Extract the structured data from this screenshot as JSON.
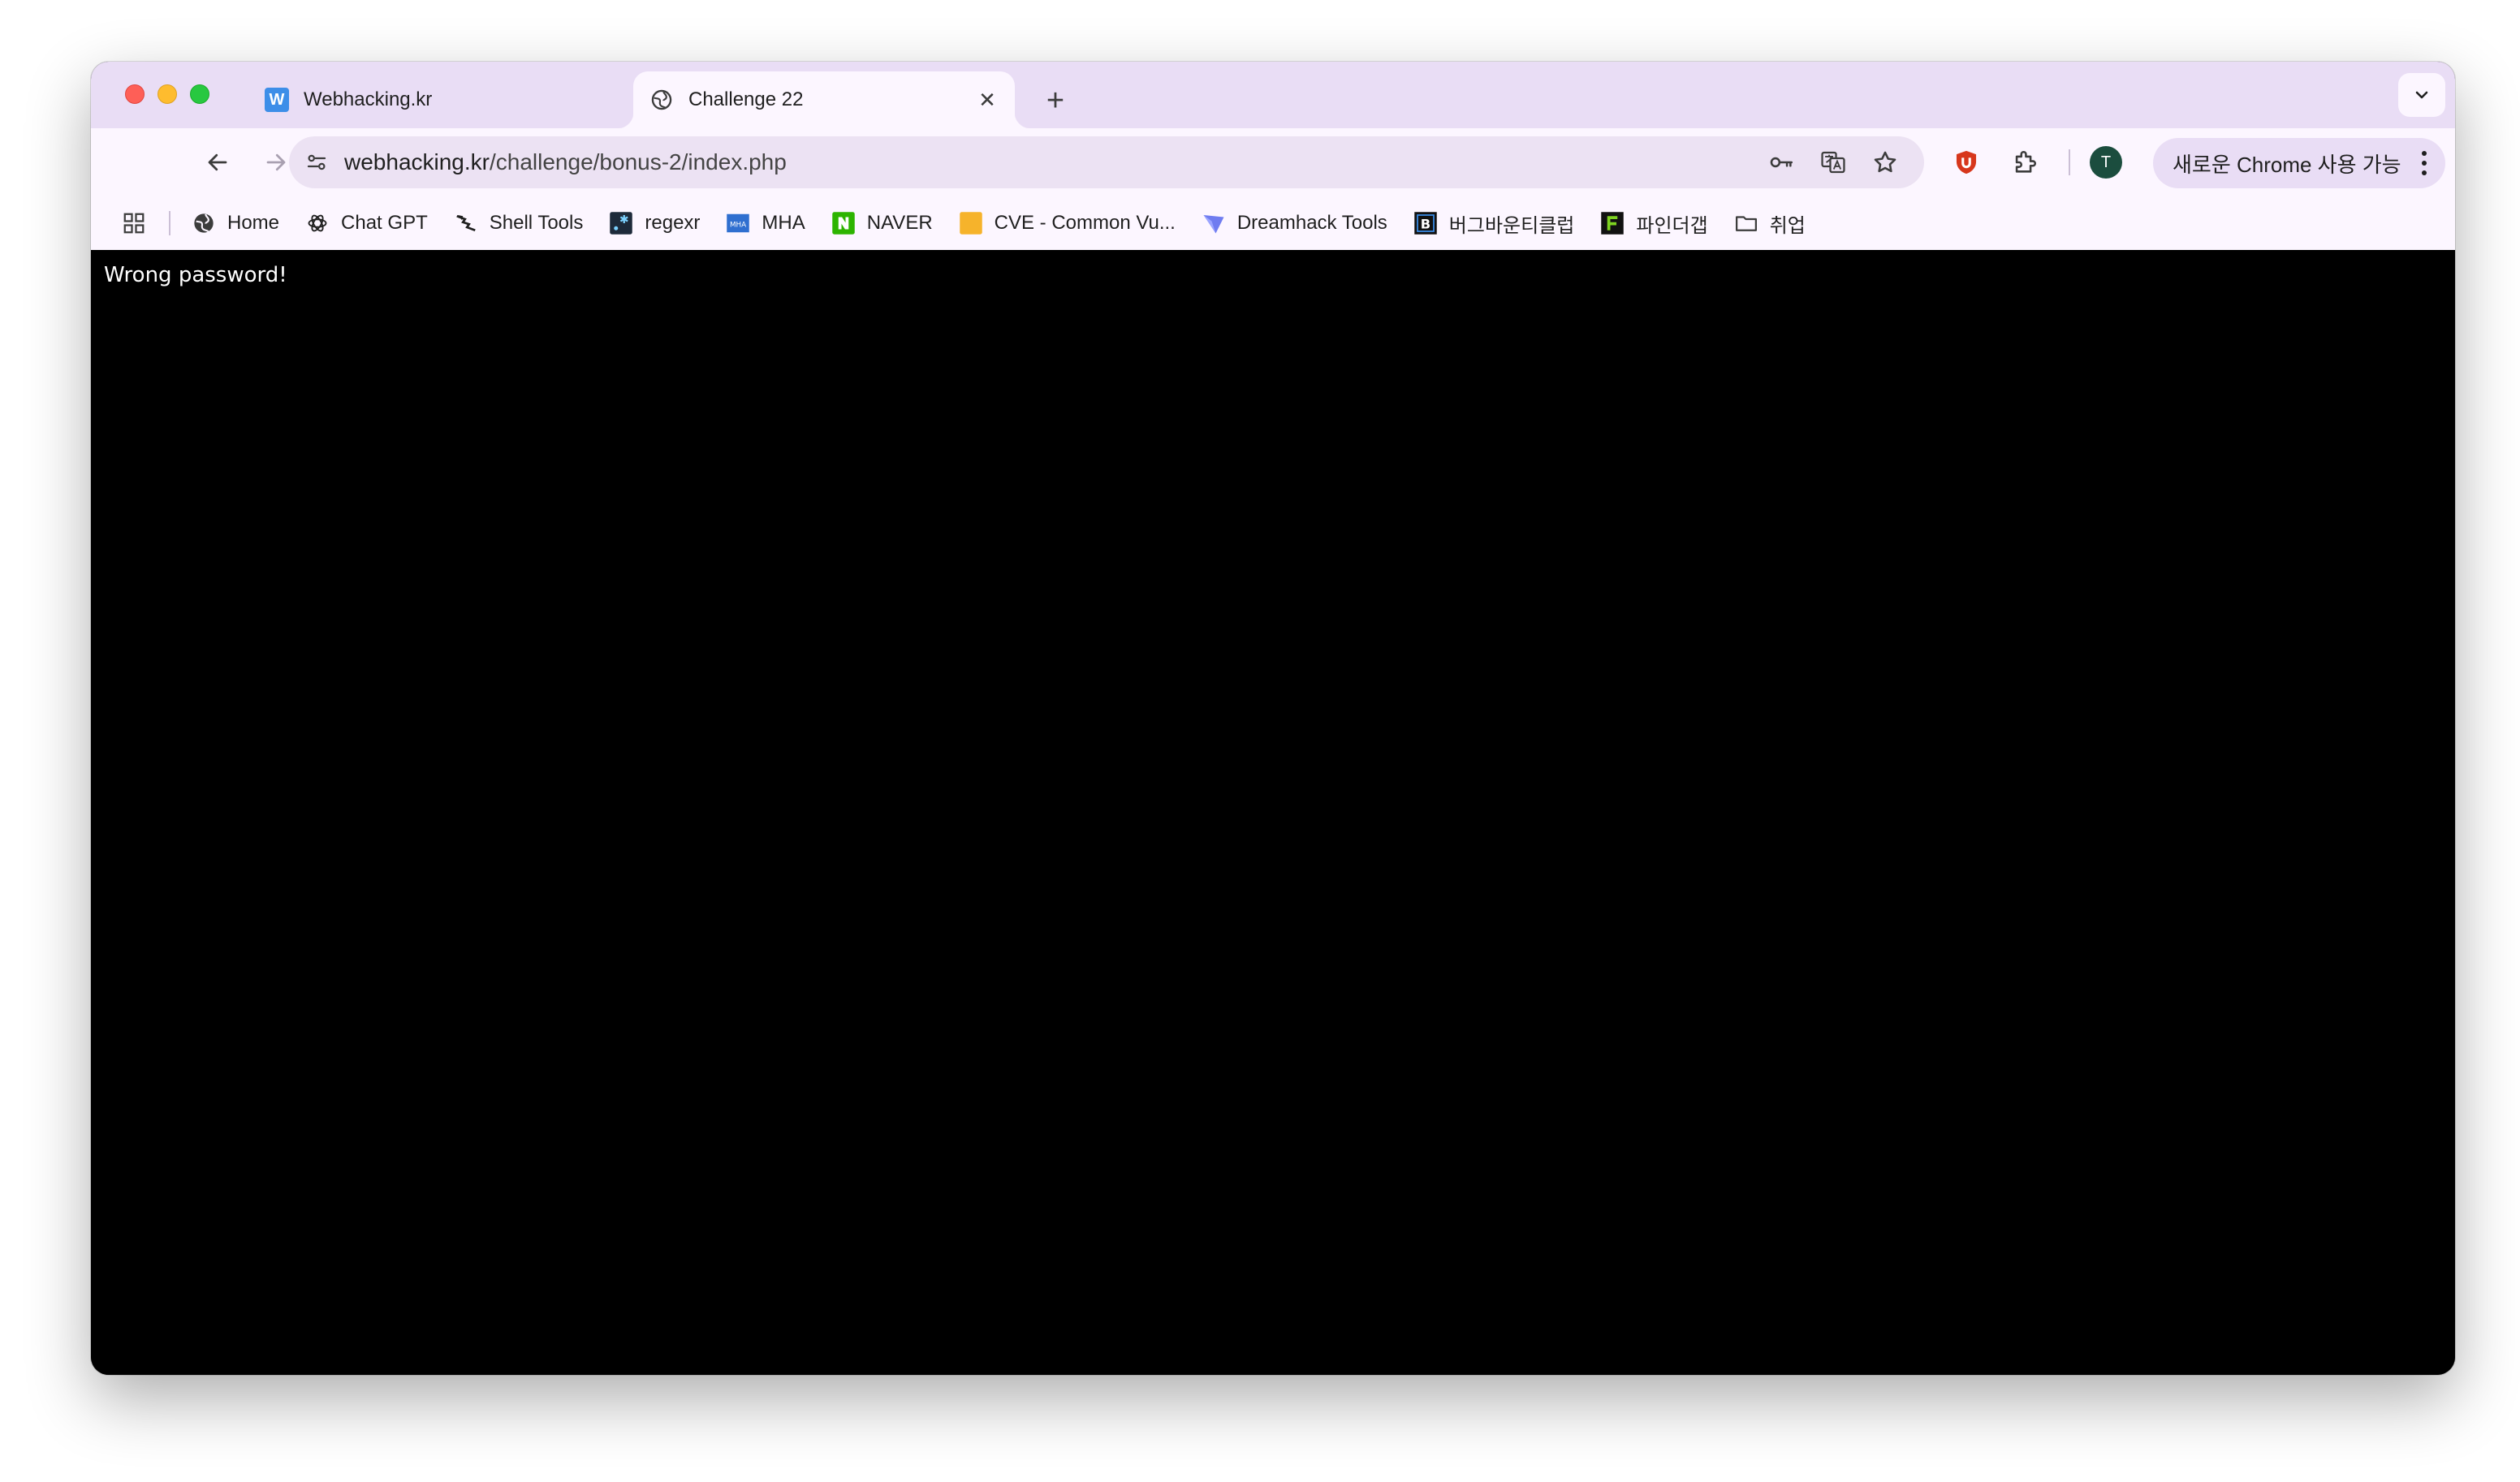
{
  "tabs": [
    {
      "title": "Webhacking.kr",
      "favicon": "W",
      "active": false
    },
    {
      "title": "Challenge 22",
      "favicon": "globe-icon",
      "active": true
    }
  ],
  "toolbar": {
    "url_host": "webhacking.kr",
    "url_path": "/challenge/bonus-2/index.php",
    "avatar_letter": "T",
    "chrome_pill_label": "새로운 Chrome 사용 가능"
  },
  "bookmarks": [
    {
      "label": "Home",
      "icon": "globe-icon"
    },
    {
      "label": "Chat GPT",
      "icon": "openai-icon"
    },
    {
      "label": "Shell Tools",
      "icon": "shell-tools-icon"
    },
    {
      "label": "regexr",
      "icon": "regexr-icon"
    },
    {
      "label": "MHA",
      "icon": "mha-icon"
    },
    {
      "label": "NAVER",
      "icon": "naver-icon"
    },
    {
      "label": "CVE - Common Vu...",
      "icon": "cve-icon"
    },
    {
      "label": "Dreamhack Tools",
      "icon": "dreamhack-icon"
    },
    {
      "label": "버그바운티클럽",
      "icon": "bugbounty-icon"
    },
    {
      "label": "파인더갭",
      "icon": "findergap-icon"
    },
    {
      "label": "취업",
      "icon": "folder-icon"
    }
  ],
  "page": {
    "message": "Wrong password!"
  },
  "colors": {
    "tabstrip": "#e9ddf5",
    "toolbar": "#fcf6ff",
    "page_bg": "#000000",
    "page_text": "#ffffff"
  }
}
